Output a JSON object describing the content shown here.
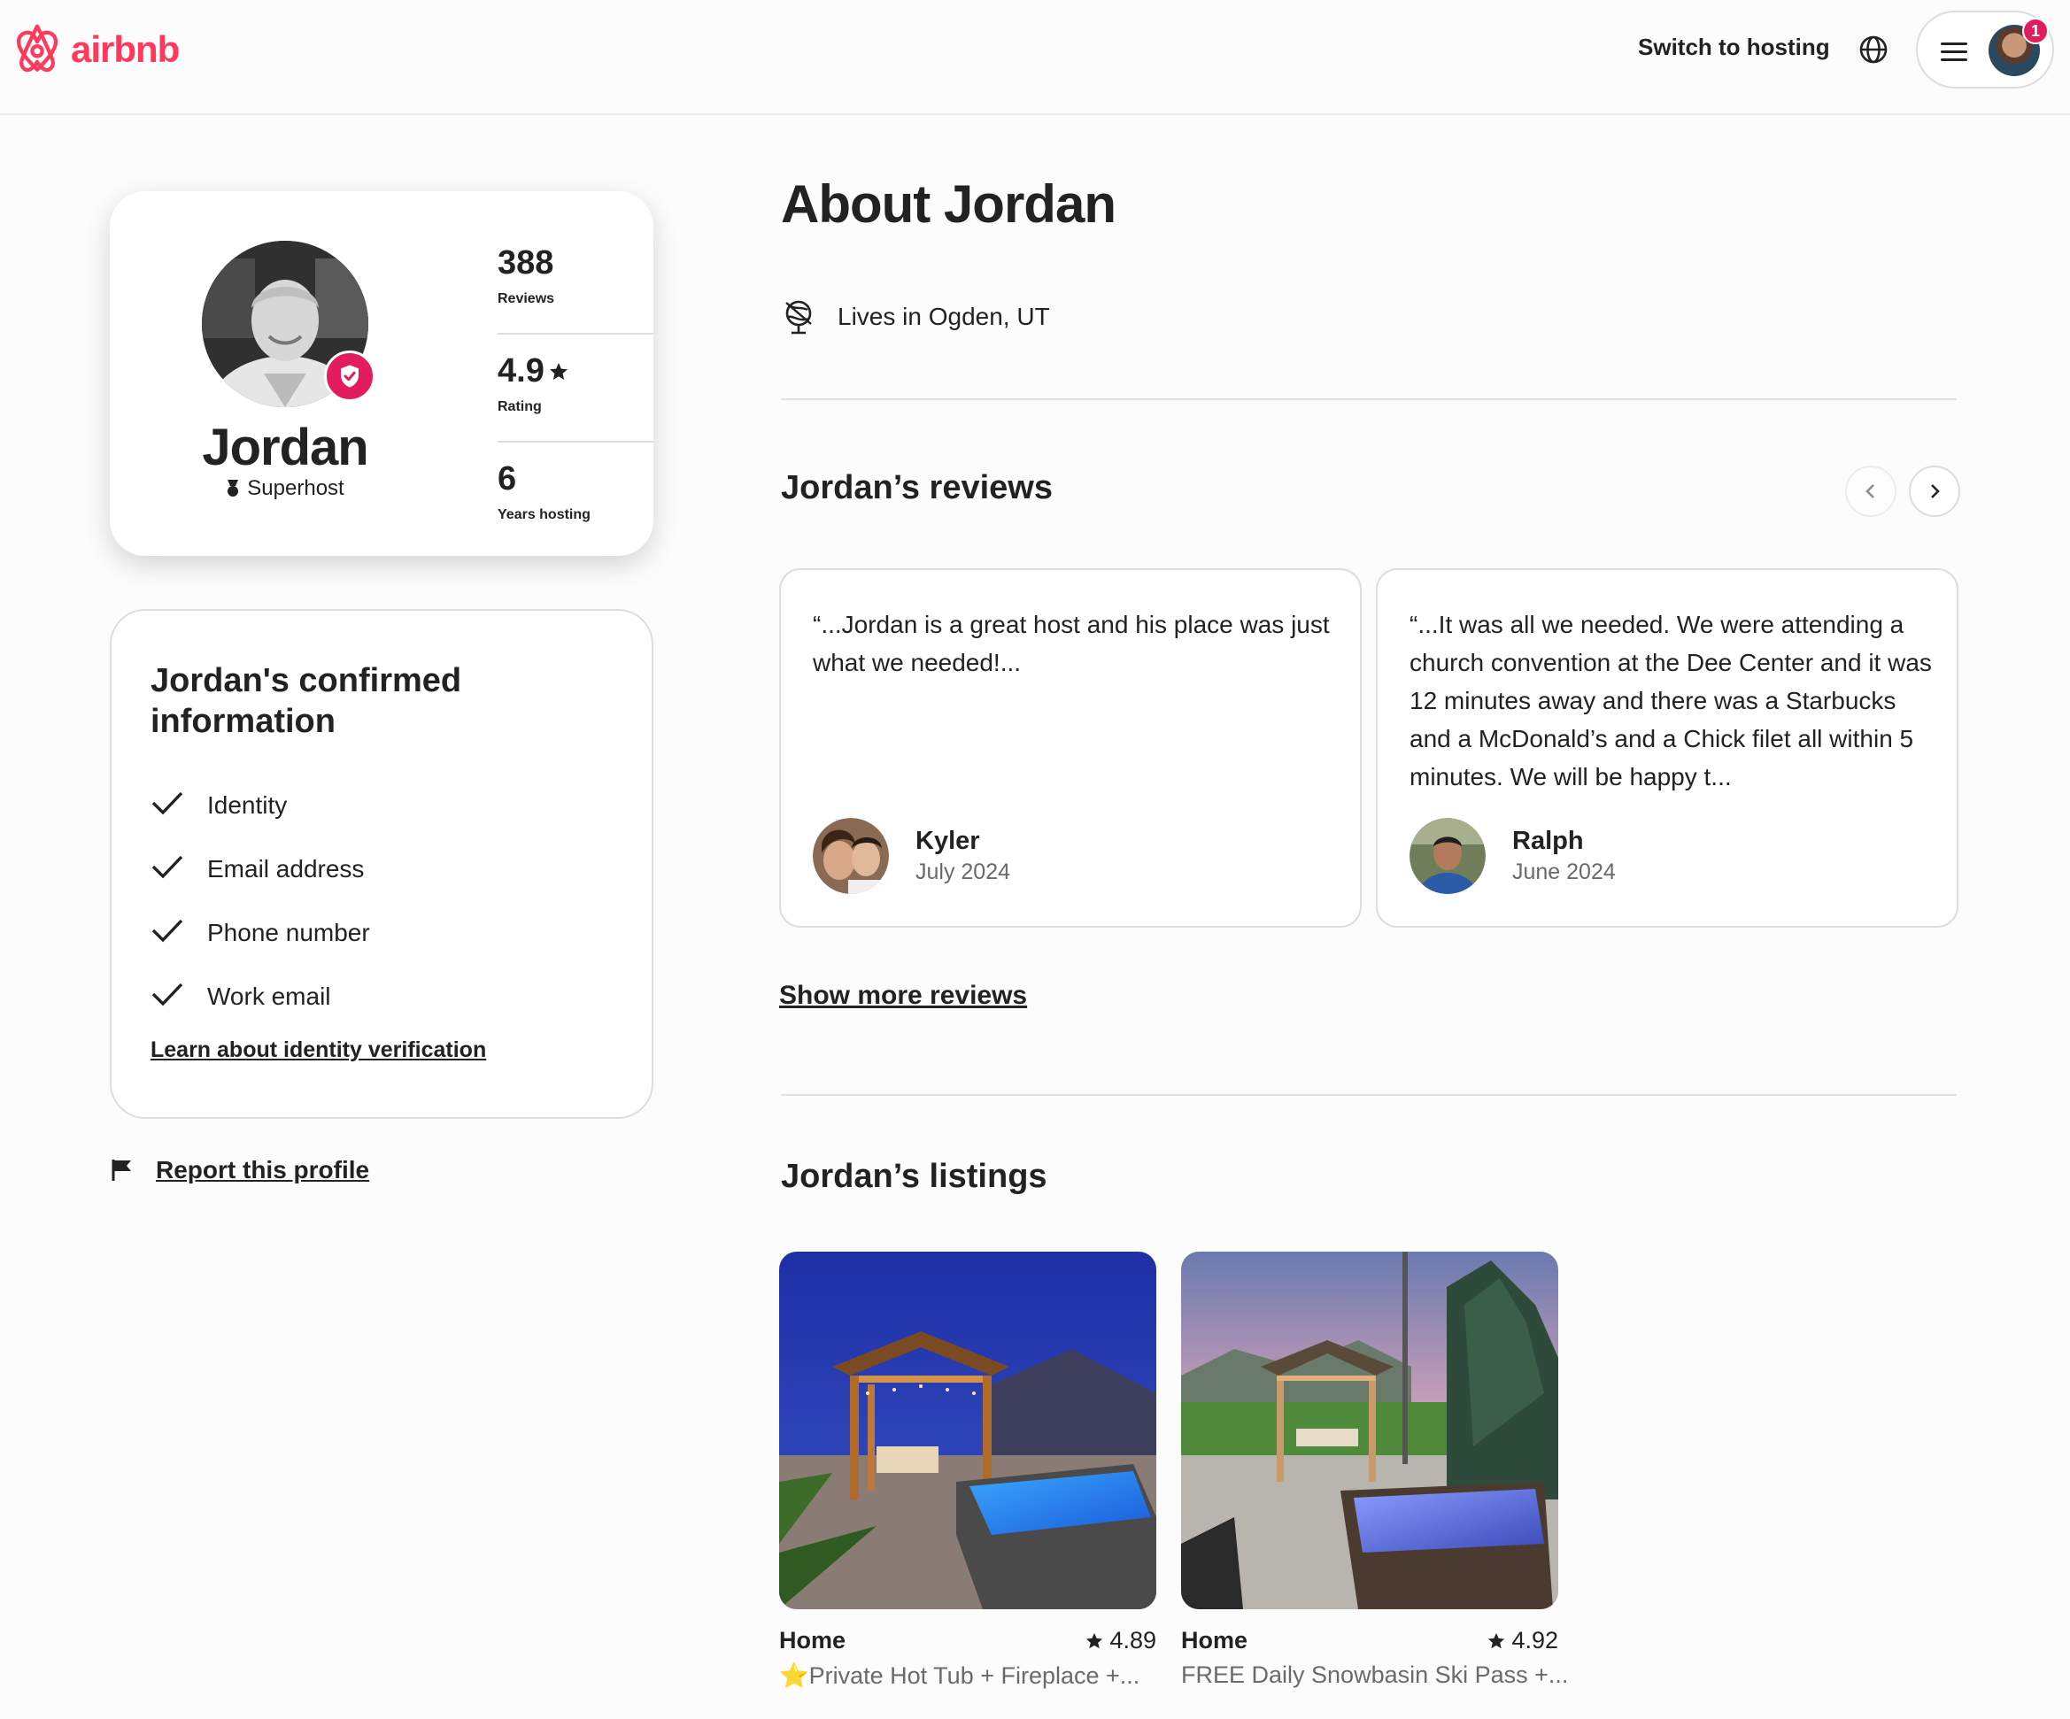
{
  "header": {
    "logo_text": "airbnb",
    "switch_hosting": "Switch to hosting",
    "notification_count": "1"
  },
  "profile_card": {
    "name": "Jordan",
    "superhost_label": "Superhost",
    "stats": [
      {
        "value": "388",
        "label": "Reviews"
      },
      {
        "value": "4.9",
        "label": "Rating"
      },
      {
        "value": "6",
        "label": "Years hosting"
      }
    ]
  },
  "confirmed": {
    "title": "Jordan's confirmed information",
    "items": [
      "Identity",
      "Email address",
      "Phone number",
      "Work email"
    ],
    "learn_link": "Learn about identity verification"
  },
  "report": {
    "label": "Report this profile"
  },
  "about": {
    "title": "About Jordan",
    "lives_in": "Lives in Ogden, UT"
  },
  "reviews": {
    "title": "Jordan’s reviews",
    "items": [
      {
        "text": "“...Jordan is a great host and his place was just what we needed!...",
        "name": "Kyler",
        "date": "July 2024"
      },
      {
        "text": "“...It was all we needed. We were attending a church convention at the Dee Center and it was 12 minutes away and there was a Starbucks and a McDonald’s and a Chick filet all within 5 minutes. We will be happy t...",
        "name": "Ralph",
        "date": "June 2024"
      }
    ],
    "show_more": "Show more reviews"
  },
  "listings": {
    "title": "Jordan’s listings",
    "items": [
      {
        "type": "Home",
        "rating": "4.89",
        "description": "⭐Private Hot Tub + Fireplace +..."
      },
      {
        "type": "Home",
        "rating": "4.92",
        "description": "FREE Daily Snowbasin Ski Pass +..."
      }
    ]
  },
  "colors": {
    "brand": "#ff385c",
    "badge": "#e31c5f",
    "text": "#222222",
    "muted": "#6a6a6a",
    "border": "#dddddd"
  }
}
